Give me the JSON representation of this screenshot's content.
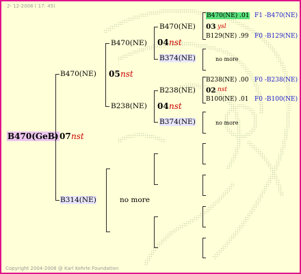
{
  "header": {
    "date": "2- 12-2008 ( 17: 45)"
  },
  "footer": {
    "copyright": "Copyright 2004-2008 @ Karl Kehrle Foundation"
  },
  "root": {
    "name": "B470(GeB)",
    "year": "07",
    "note": "nst"
  },
  "gen1": {
    "father": {
      "name": "B470(NE)",
      "year": "05",
      "note": "nst"
    },
    "mother": {
      "name": "B314(NE)",
      "no_more": "no more"
    }
  },
  "gen2": {
    "ff": {
      "name": "B470(NE)",
      "year": "04",
      "note": "nst"
    },
    "fm": {
      "name": "B238(NE)",
      "year": "04",
      "note": "nst"
    }
  },
  "gen3": {
    "fff": {
      "name": "B470(NE)"
    },
    "ffm": {
      "name": "B374(NE)"
    },
    "fmf": {
      "name": "B238(NE)"
    },
    "fmm": {
      "name": "B374(NE)"
    }
  },
  "gen4": {
    "a": {
      "name": "B470(NE)",
      "coef": ".01",
      "link": "F1 -B470(NE)"
    },
    "a_year": "03",
    "a_note": "ysl",
    "b": {
      "name": "B129(NE)",
      "coef": ".99",
      "link": "F0 -B129(NE)"
    },
    "c_no_more": "no more",
    "d": {
      "name": "B238(NE)",
      "coef": ".00",
      "link": "F0 -B238(NE)"
    },
    "d_year": "02",
    "d_note": "nst",
    "e": {
      "name": "B100(NE)",
      "coef": ".01",
      "link": "F0 -B100(NE)"
    },
    "f_no_more": "no more"
  },
  "colors": {
    "border": "#e0138c",
    "background": "#ffffd8",
    "link": "#1c1ccc",
    "note": "#cc0000"
  }
}
